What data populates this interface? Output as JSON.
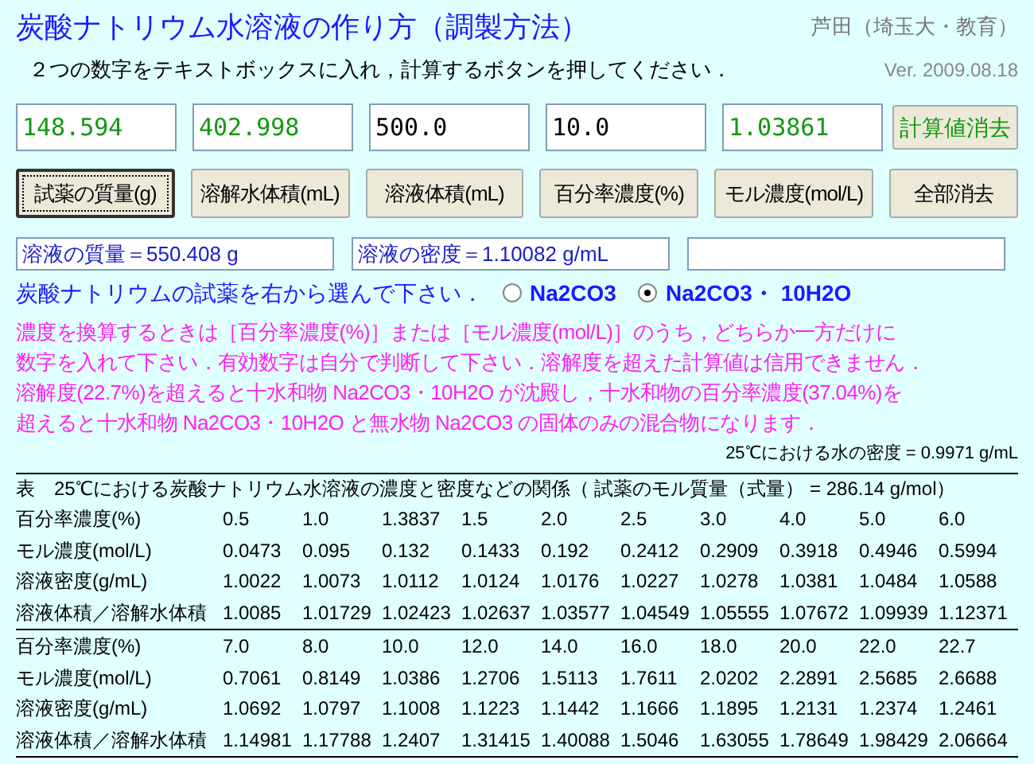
{
  "title": "炭酸ナトリウム水溶液の作り方（調製方法）",
  "author": "芦田（埼玉大・教育）",
  "instruction": "２つの数字をテキストボックスに入れ，計算するボタンを押してください．",
  "version": "Ver. 2009.08.18",
  "inputs": [
    {
      "value": "148.594",
      "computed": true
    },
    {
      "value": "402.998",
      "computed": true
    },
    {
      "value": "500.0",
      "computed": false
    },
    {
      "value": "10.0",
      "computed": false
    },
    {
      "value": "1.03861",
      "computed": true
    }
  ],
  "clear_results_button": "計算値消去",
  "buttons": [
    {
      "label": "試薬の質量(g)",
      "focused": true
    },
    {
      "label": "溶解水体積(mL)",
      "focused": false
    },
    {
      "label": "溶液体積(mL)",
      "focused": false
    },
    {
      "label": "百分率濃度(%)",
      "focused": false
    },
    {
      "label": "モル濃度(mol/L)",
      "focused": false
    },
    {
      "label": "全部消去",
      "focused": false
    }
  ],
  "results": [
    {
      "value": "溶液の質量＝550.408 g"
    },
    {
      "value": "溶液の密度＝1.10082 g/mL"
    }
  ],
  "reagent_prompt": "炭酸ナトリウムの試薬を右から選んで下さい．",
  "reagents": [
    {
      "label": "Na2CO3",
      "selected": false
    },
    {
      "label": "Na2CO3・ 10H2O",
      "selected": true
    }
  ],
  "notes": [
    "濃度を換算するときは［百分率濃度(%)］または［モル濃度(mol/L)］のうち，どちらか一方だけに",
    "数字を入れて下さい．有効数字は自分で判断して下さい．溶解度を超えた計算値は信用できません．",
    "溶解度(22.7%)を超えると十水和物 Na2CO3・10H2O が沈殿し，十水和物の百分率濃度(37.04%)を",
    "超えると十水和物 Na2CO3・10H2O と無水物 Na2CO3 の固体のみの混合物になります．"
  ],
  "water_density": "25℃における水の密度 = 0.9971 g/mL",
  "table": {
    "caption": "表　25℃における炭酸ナトリウム水溶液の濃度と密度などの関係（ 試薬のモル質量（式量） = 286.14 g/mol）",
    "blocks": [
      [
        [
          "百分率濃度(%)",
          "0.5",
          "1.0",
          "1.3837",
          "1.5",
          "2.0",
          "2.5",
          "3.0",
          "4.0",
          "5.0",
          "6.0"
        ],
        [
          "モル濃度(mol/L)",
          "0.0473",
          "0.095",
          "0.132",
          "0.1433",
          "0.192",
          "0.2412",
          "0.2909",
          "0.3918",
          "0.4946",
          "0.5994"
        ],
        [
          "溶液密度(g/mL)",
          "1.0022",
          "1.0073",
          "1.0112",
          "1.0124",
          "1.0176",
          "1.0227",
          "1.0278",
          "1.0381",
          "1.0484",
          "1.0588"
        ],
        [
          "溶液体積／溶解水体積",
          "1.0085",
          "1.01729",
          "1.02423",
          "1.02637",
          "1.03577",
          "1.04549",
          "1.05555",
          "1.07672",
          "1.09939",
          "1.12371"
        ]
      ],
      [
        [
          "百分率濃度(%)",
          "7.0",
          "8.0",
          "10.0",
          "12.0",
          "14.0",
          "16.0",
          "18.0",
          "20.0",
          "22.0",
          "22.7"
        ],
        [
          "モル濃度(mol/L)",
          "0.7061",
          "0.8149",
          "1.0386",
          "1.2706",
          "1.5113",
          "1.7611",
          "2.0202",
          "2.2891",
          "2.5685",
          "2.6688"
        ],
        [
          "溶液密度(g/mL)",
          "1.0692",
          "1.0797",
          "1.1008",
          "1.1223",
          "1.1442",
          "1.1666",
          "1.1895",
          "1.2131",
          "1.2374",
          "1.2461"
        ],
        [
          "溶液体積／溶解水体積",
          "1.14981",
          "1.17788",
          "1.2407",
          "1.31415",
          "1.40088",
          "1.5046",
          "1.63055",
          "1.78649",
          "1.98429",
          "2.06664"
        ]
      ]
    ]
  }
}
